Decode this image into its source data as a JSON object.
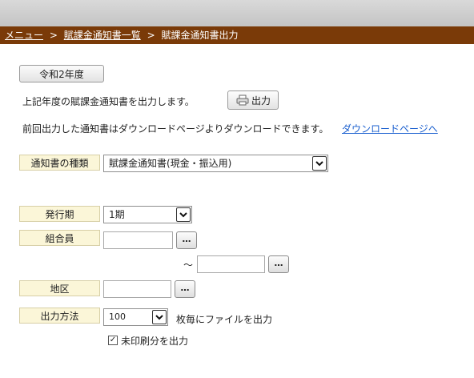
{
  "breadcrumb": {
    "menu": "メニュー",
    "list": "賦課金通知書一覧",
    "current": "賦課金通知書出力",
    "separator": ">"
  },
  "year_button": "令和2年度",
  "description_print": "上記年度の賦課金通知書を出力します。",
  "print_button": {
    "label": "出力",
    "icon": "printer-icon"
  },
  "description_download": "前回出力した通知書はダウンロードページよりダウンロードできます。",
  "download_link": "ダウンロードページへ",
  "form": {
    "notice_type": {
      "label": "通知書の種類",
      "value": "賦課金通知書(現金・振込用)"
    },
    "issue_period": {
      "label": "発行期",
      "value": "1期"
    },
    "member": {
      "label": "組合員",
      "from": "",
      "to": "",
      "range_sep": "〜",
      "lookup_label": "…"
    },
    "district": {
      "label": "地区",
      "value": "",
      "lookup_label": "…"
    },
    "output_method": {
      "label": "出力方法",
      "value": "100",
      "suffix": "枚毎にファイルを出力"
    },
    "unprinted_only": {
      "label": "未印刷分を出力",
      "checked": true
    }
  },
  "colors": {
    "breadcrumb_bg": "#7a3a08",
    "label_bg": "#fbf6d8",
    "link": "#1a5fcf"
  }
}
